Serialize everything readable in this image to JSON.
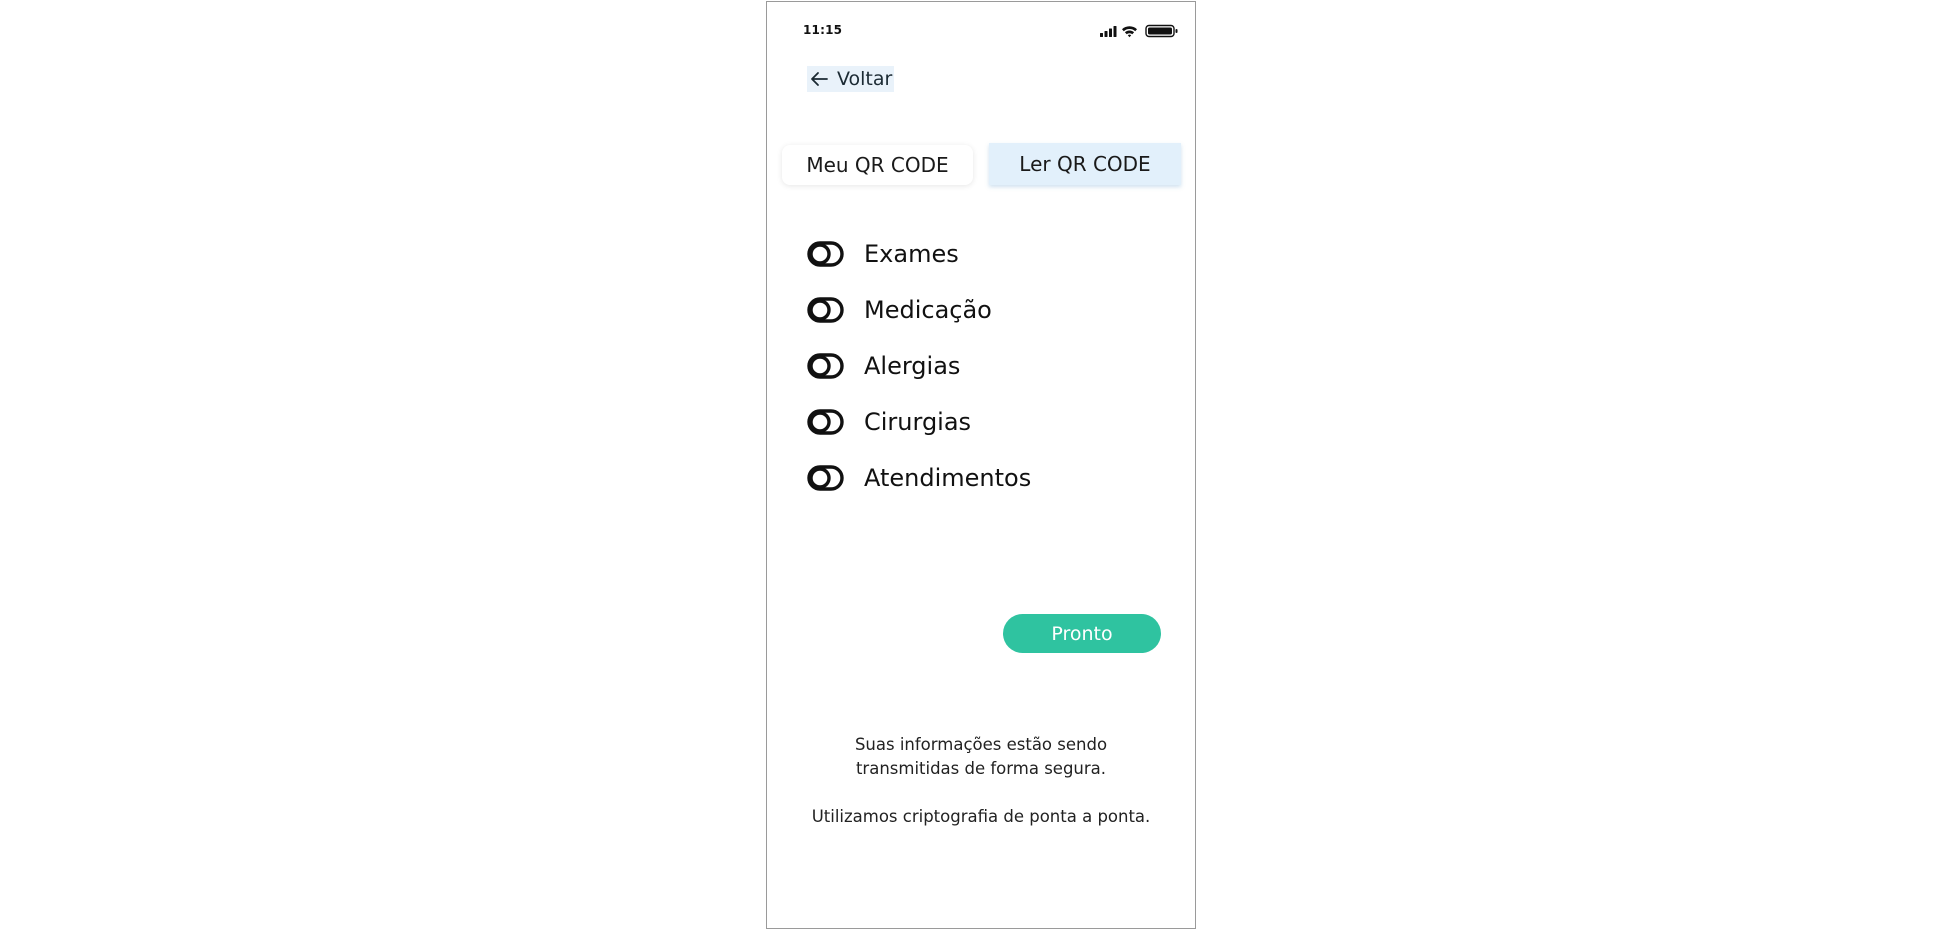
{
  "status_bar": {
    "time": "11:15",
    "icons": [
      "signal-icon",
      "wifi-icon",
      "battery-icon"
    ]
  },
  "back": {
    "label": "Voltar",
    "icon": "arrow-left-icon"
  },
  "tabs": [
    {
      "label": "Meu QR CODE",
      "selected": false
    },
    {
      "label": "Ler QR CODE",
      "selected": true
    }
  ],
  "options": [
    {
      "label": "Exames",
      "icon": "toggle-icon"
    },
    {
      "label": "Medicação",
      "icon": "toggle-icon"
    },
    {
      "label": "Alergias",
      "icon": "toggle-icon"
    },
    {
      "label": "Cirurgias",
      "icon": "toggle-icon"
    },
    {
      "label": "Atendimentos",
      "icon": "toggle-icon"
    }
  ],
  "done_button": {
    "label": "Pronto"
  },
  "footer": {
    "line1": "Suas informações estão sendo",
    "line2": "transmitidas de forma segura.",
    "line3": "Utilizamos criptografia de ponta a ponta."
  },
  "colors": {
    "accent": "#2fc3a0",
    "tab_selected_bg": "#e2f0fb",
    "back_bg": "#e9f2fa"
  }
}
